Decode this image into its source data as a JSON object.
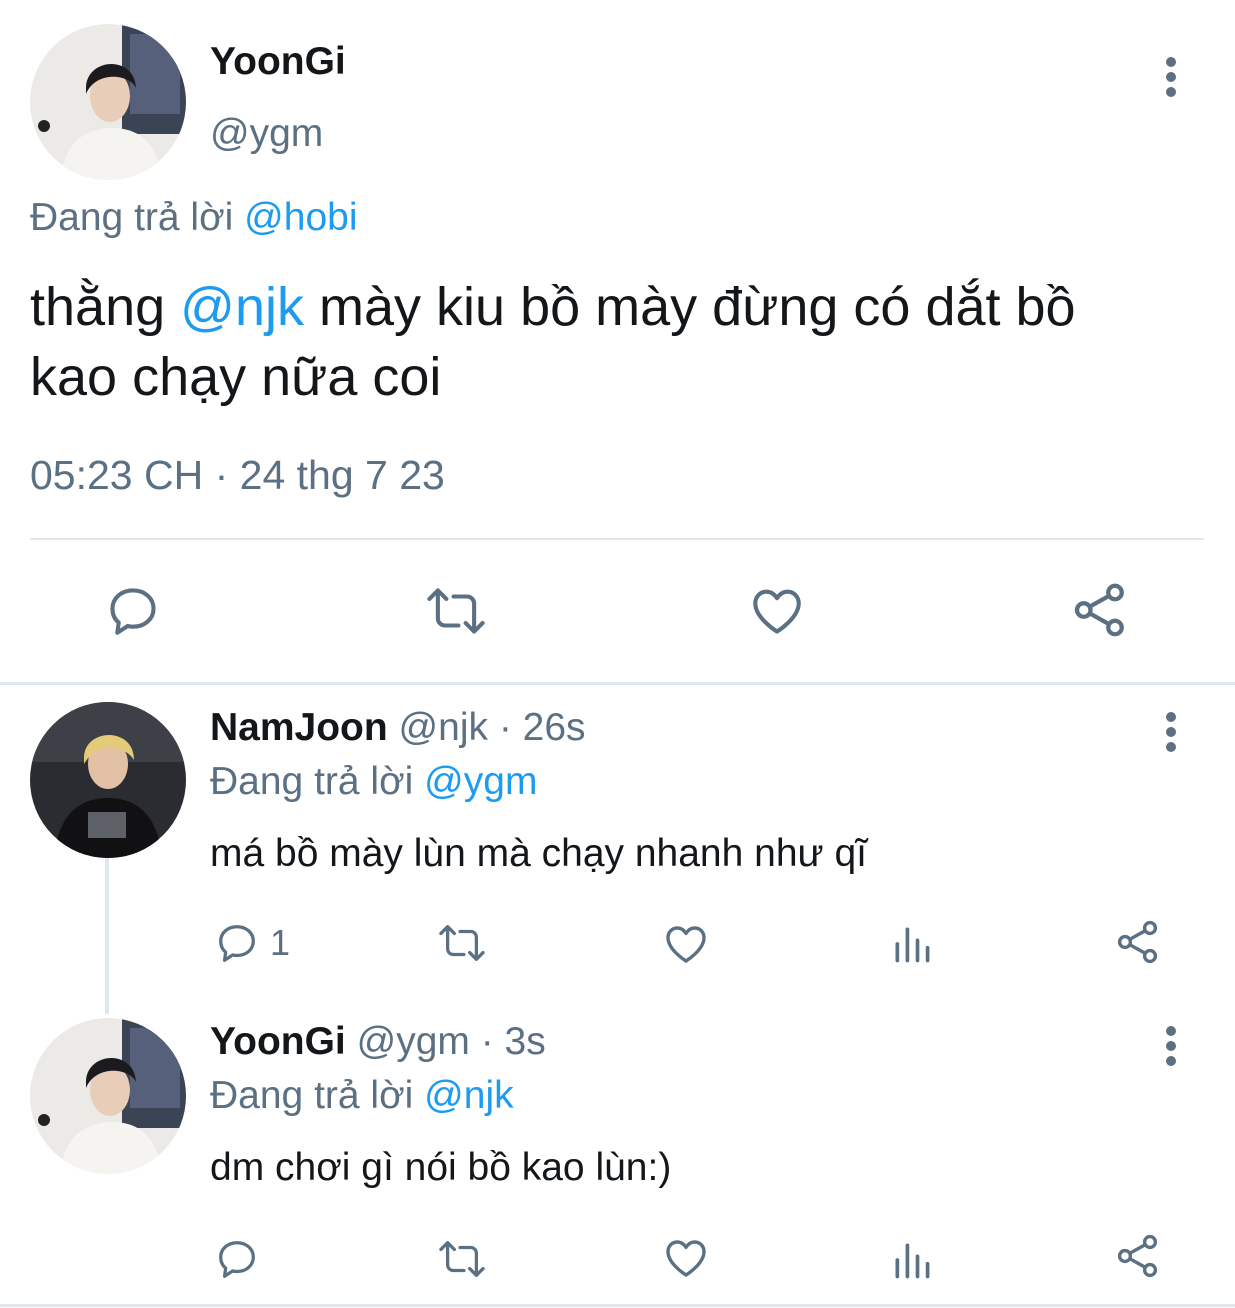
{
  "main_tweet": {
    "display_name": "YoonGi",
    "handle": "@ygm",
    "reply_prefix": "Đang trả lời",
    "reply_to": "@hobi",
    "text_before": "thằng",
    "mention": "@njk",
    "text_after_line1": "mày kiu bồ mày đừng có dắt bồ",
    "text_line2": "kao chạy nữa coi",
    "timestamp": "05:23 CH · 24 thg 7 23",
    "actions": [
      "reply-icon",
      "retweet-icon",
      "like-icon",
      "share-icon"
    ]
  },
  "replies": [
    {
      "display_name": "NamJoon",
      "handle": "@njk",
      "age": "· 26s",
      "reply_prefix": "Đang trả lời",
      "reply_to": "@ygm",
      "text": "má bồ mày lùn mà chạy nhanh như qĩ",
      "reply_count": "1",
      "actions": [
        "reply-icon",
        "retweet-icon",
        "like-icon",
        "analytics-icon",
        "share-icon"
      ]
    },
    {
      "display_name": "YoonGi",
      "handle": "@ygm",
      "age": "· 3s",
      "reply_prefix": "Đang trả lời",
      "reply_to": "@njk",
      "text": "dm chơi gì nói bồ kao lùn:)",
      "reply_count": "",
      "actions": [
        "reply-icon",
        "retweet-icon",
        "like-icon",
        "analytics-icon",
        "share-icon"
      ]
    }
  ],
  "colors": {
    "link": "#1d9bf0",
    "muted": "#5b7083",
    "icon": "#5b7083",
    "divider": "#e1e8ed"
  }
}
